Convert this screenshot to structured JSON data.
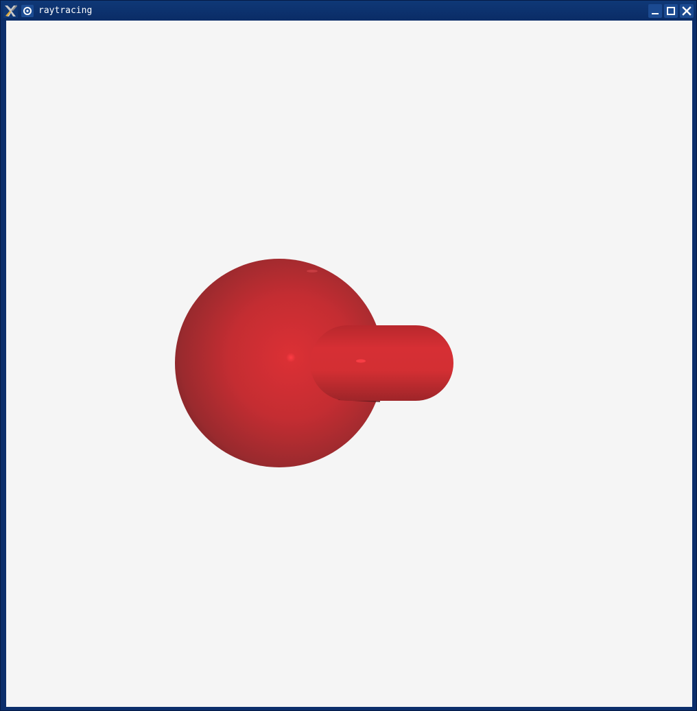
{
  "window": {
    "title": "raytracing"
  },
  "icons": {
    "app": "app-icon",
    "menu": "window-menu-icon",
    "minimize": "minimize-icon",
    "maximize": "maximize-icon",
    "close": "close-icon"
  },
  "colors": {
    "titlebar": "#0c2e6b",
    "canvas_background": "#f5f5f5",
    "object_red": "#d32f33"
  }
}
